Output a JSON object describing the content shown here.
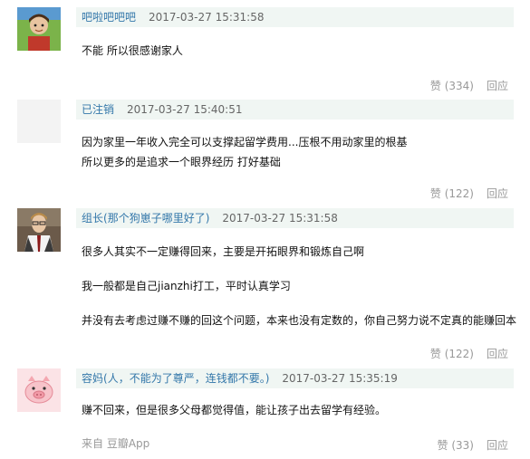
{
  "comments": [
    {
      "author": "吧啦吧吧吧",
      "signature": "",
      "time": "2017-03-27 15:31:58",
      "lines": [
        "不能 所以很感谢家人"
      ],
      "like_label": "赞",
      "like_count": "(334)",
      "reply_label": "回应"
    },
    {
      "author": "已注销",
      "signature": "",
      "time": "2017-03-27 15:40:51",
      "lines": [
        "因为家里一年收入完全可以支撑起留学费用...压根不用动家里的根基",
        "所以更多的是追求一个眼界经历 打好基础"
      ],
      "like_label": "赞",
      "like_count": "(122)",
      "reply_label": "回应"
    },
    {
      "author": "组长",
      "signature": "(那个狗崽子哪里好了)",
      "time": "2017-03-27 15:31:58",
      "lines": [
        "很多人其实不一定赚得回来，主要是开拓眼界和锻炼自己啊",
        "我一般都是自己jianzhi打工，平时认真学习",
        "并没有去考虑过赚不赚的回这个问题，本来也没有定数的，你自己努力说不定真的能赚回本"
      ],
      "like_label": "赞",
      "like_count": "(122)",
      "reply_label": "回应"
    },
    {
      "author": "容妈",
      "signature": "(人，不能为了尊严，连钱都不要。)",
      "time": "2017-03-27 15:35:19",
      "lines": [
        "赚不回来，但是很多父母都觉得值，能让孩子出去留学有经验。"
      ],
      "source": "来自 豆瓣App",
      "like_label": "赞",
      "like_count": "(33)",
      "reply_label": "回应"
    }
  ],
  "colors": {
    "link": "#3377aa",
    "meta_bg": "#f0f6f3",
    "muted": "#999999"
  }
}
